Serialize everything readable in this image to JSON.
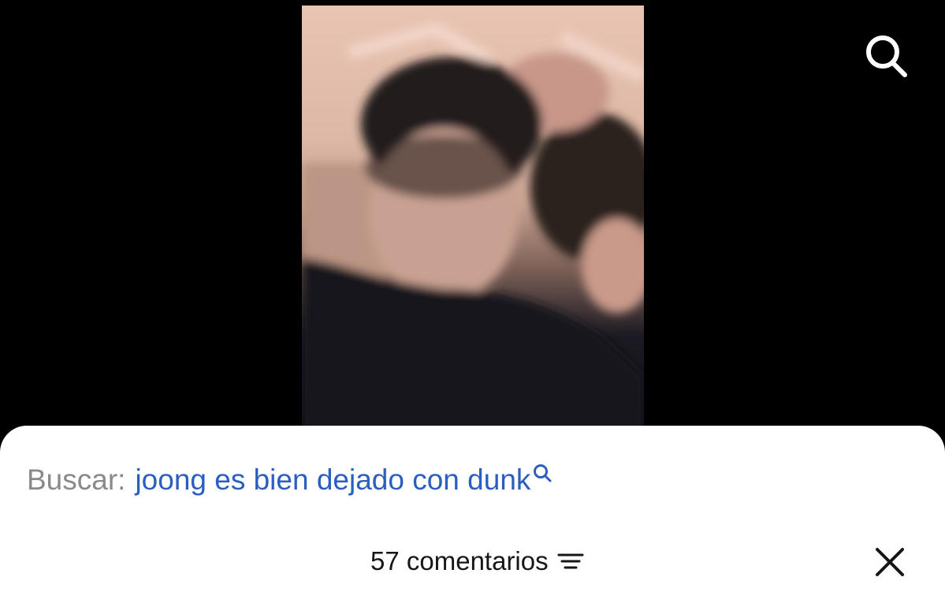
{
  "search_bar": {
    "prefix": "Buscar:",
    "query": "joong es bien dejado con dunk"
  },
  "comments": {
    "count_label": "57 comentarios"
  },
  "icons": {
    "top_search": "search-icon",
    "inline_search": "search-icon",
    "sort": "sort-icon",
    "close": "close-icon"
  },
  "colors": {
    "background": "#000000",
    "sheet": "#ffffff",
    "link_blue": "#2b5fbf",
    "prefix_gray": "#8a8a8a"
  }
}
